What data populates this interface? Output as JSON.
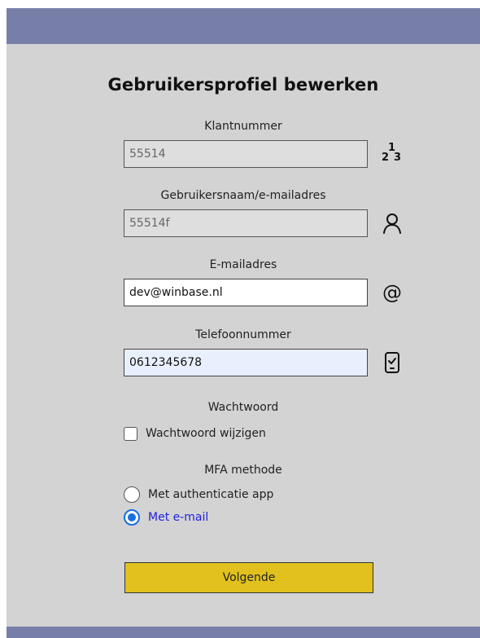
{
  "form": {
    "title": "Gebruikersprofiel bewerken",
    "customer_number": {
      "label": "Klantnummer",
      "value": "55514",
      "icon": "numbers-123-icon",
      "icon_digits": [
        "1",
        "2",
        "3"
      ]
    },
    "username": {
      "label": "Gebruikersnaam/e-mailadres",
      "value": "55514f",
      "icon": "user-icon"
    },
    "email": {
      "label": "E-mailadres",
      "value": "dev@winbase.nl",
      "icon": "at-sign-icon",
      "icon_glyph": "@"
    },
    "phone": {
      "label": "Telefoonnummer",
      "value": "0612345678",
      "icon": "phone-check-icon"
    },
    "password": {
      "section_label": "Wachtwoord",
      "change_checkbox_label": "Wachtwoord wijzigen",
      "change_checked": false
    },
    "mfa": {
      "section_label": "MFA methode",
      "options": [
        {
          "label": "Met authenticatie app",
          "selected": false
        },
        {
          "label": "Met e-mail",
          "selected": true
        }
      ]
    },
    "submit_label": "Volgende"
  },
  "colors": {
    "header_bar": "#777fa8",
    "background": "#d3d3d3",
    "button": "#e2c11f",
    "radio_accent": "#1a6fe0",
    "selected_option_text": "#2222dd"
  }
}
